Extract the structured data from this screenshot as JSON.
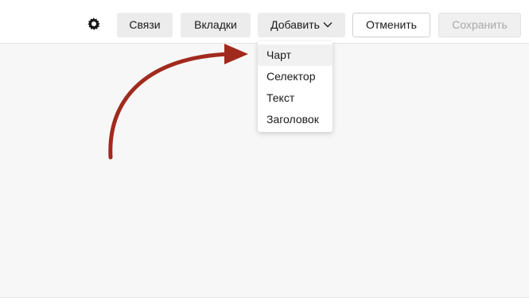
{
  "toolbar": {
    "settings_icon": "gear-icon",
    "links_label": "Связи",
    "tabs_label": "Вкладки",
    "add_label": "Добавить",
    "add_chevron_icon": "chevron-down-icon",
    "cancel_label": "Отменить",
    "save_label": "Сохранить"
  },
  "add_menu": {
    "items": [
      {
        "label": "Чарт"
      },
      {
        "label": "Селектор"
      },
      {
        "label": "Текст"
      },
      {
        "label": "Заголовок"
      }
    ]
  },
  "colors": {
    "annotation_arrow": "#a12a1e",
    "save_disabled_text": "#a9a9a9",
    "canvas_background": "#f7f7f7"
  }
}
